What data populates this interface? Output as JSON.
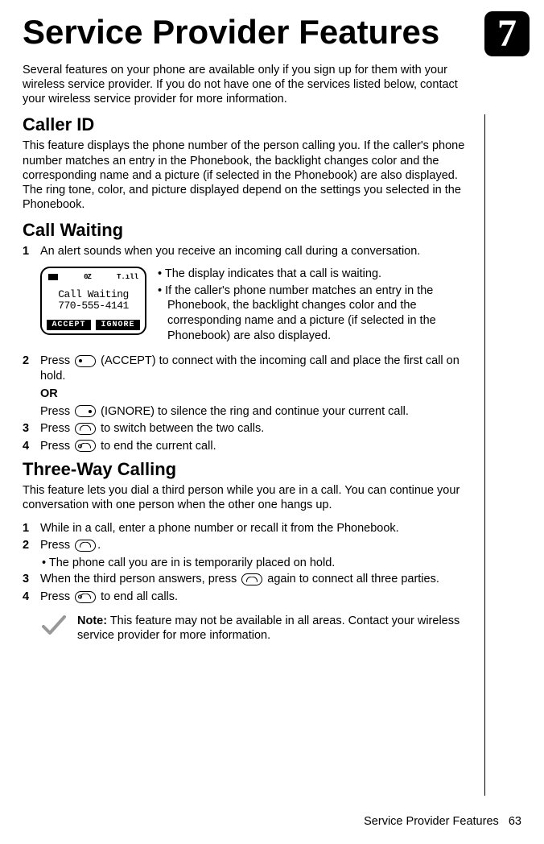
{
  "chapter_number": "7",
  "title": "Service Provider Features",
  "intro": "Several features on your phone are available only if you sign up for them with your wireless service provider. If you do not have one of the services listed below, contact your wireless service provider for more information.",
  "caller_id": {
    "heading": "Caller ID",
    "body": "This feature displays the phone number of the person calling you. If the caller's phone number matches an entry in the Phonebook, the backlight changes color and the corresponding name and a picture (if selected in the Phonebook) are also displayed. The ring tone, color, and picture displayed depend on the settings you selected in the Phonebook."
  },
  "call_waiting": {
    "heading": "Call Waiting",
    "step1": "An alert sounds when you receive an incoming call during a conversation.",
    "screen": {
      "status_mid": "0Z",
      "status_sig": "T.ıll",
      "line1": "Call Waiting",
      "line2": "770-555-4141",
      "soft_left": "ACCEPT",
      "soft_right": "IGNORE"
    },
    "bullets": [
      "The display indicates that a call is waiting.",
      "If the caller's phone number matches an entry in the Phonebook, the backlight changes color and the corresponding name and a picture (if selected in the Phonebook) are also displayed."
    ],
    "step2a": "Press ",
    "step2b": " (ACCEPT) to connect with the incoming call and place the first call on hold.",
    "step2_or": "OR",
    "step2c": "Press ",
    "step2d": " (IGNORE) to silence the ring and continue your current call.",
    "step3a": "Press ",
    "step3b": " to switch between the two calls.",
    "step4a": "Press ",
    "step4b": " to end the current call."
  },
  "three_way": {
    "heading": "Three-Way Calling",
    "intro": "This feature lets you dial a third person while you are in a call. You can continue your conversation with one person when the other one hangs up.",
    "step1": "While in a call, enter a phone number or recall it from the Phonebook.",
    "step2a": "Press ",
    "step2b": ".",
    "step2_sub": "The phone call you are in is temporarily placed on hold.",
    "step3a": "When the third person answers, press ",
    "step3b": " again to connect all three parties.",
    "step4a": "Press ",
    "step4b": " to end all calls."
  },
  "note": {
    "label": "Note:",
    "text": " This feature may not be available in all areas. Contact your wireless service provider for more information."
  },
  "footer": {
    "section": "Service Provider Features",
    "page": "63"
  }
}
